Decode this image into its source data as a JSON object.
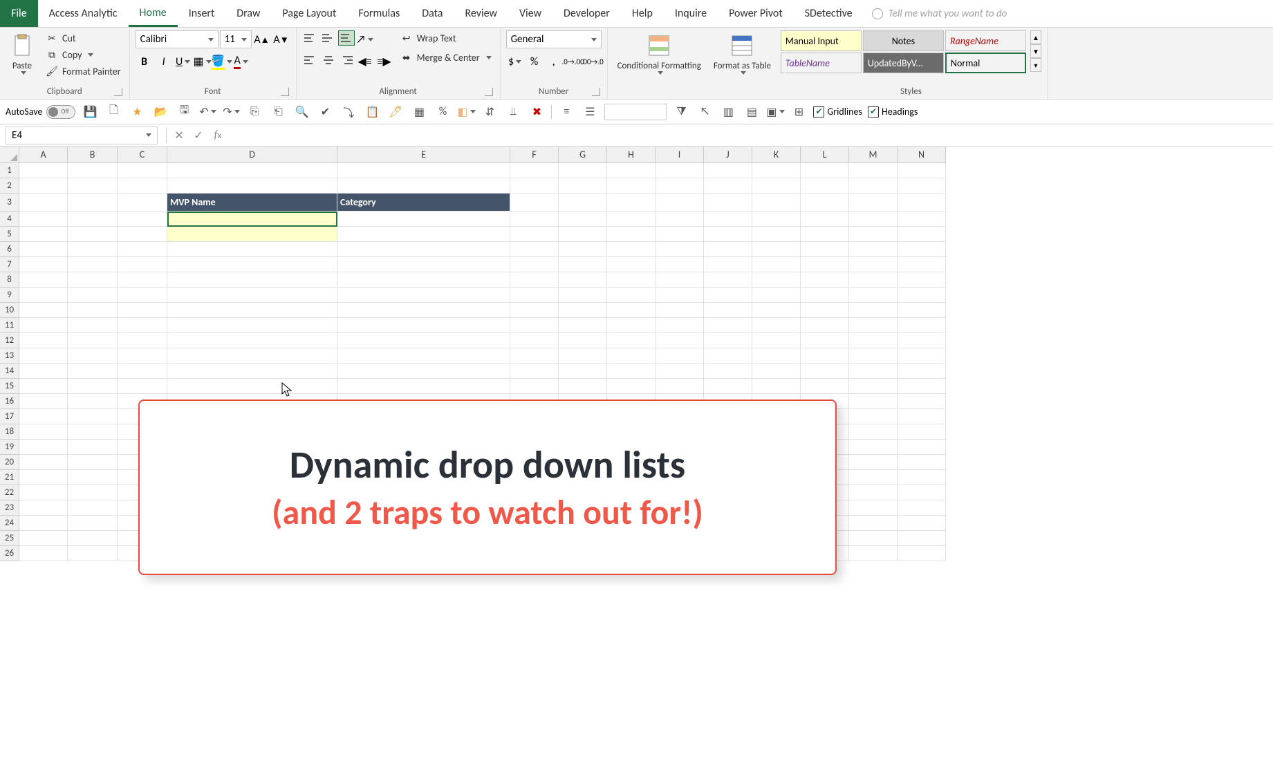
{
  "tabs": {
    "file": "File",
    "items": [
      "Access Analytic",
      "Home",
      "Insert",
      "Draw",
      "Page Layout",
      "Formulas",
      "Data",
      "Review",
      "View",
      "Developer",
      "Help",
      "Inquire",
      "Power Pivot",
      "SDetective"
    ],
    "active": "Home",
    "tell_me": "Tell me what you want to do"
  },
  "ribbon": {
    "clipboard": {
      "label": "Clipboard",
      "paste": "Paste",
      "cut": "Cut",
      "copy": "Copy",
      "format_painter": "Format Painter"
    },
    "font": {
      "label": "Font",
      "name": "Calibri",
      "size": "11"
    },
    "alignment": {
      "label": "Alignment",
      "wrap": "Wrap Text",
      "merge": "Merge & Center"
    },
    "number": {
      "label": "Number",
      "format": "General"
    },
    "styles": {
      "label": "Styles",
      "cond": "Conditional Formatting",
      "fat": "Format as Table",
      "cells": [
        {
          "text": "Manual Input",
          "bg": "#ffffcc",
          "color": "#000",
          "italic": false
        },
        {
          "text": "Notes",
          "bg": "#d9d9d9",
          "color": "#333",
          "italic": false
        },
        {
          "text": "RangeName",
          "bg": "#fff",
          "color": "#c00000",
          "italic": true
        },
        {
          "text": "TableName",
          "bg": "#fff",
          "color": "#7030a0",
          "italic": true
        },
        {
          "text": "UpdatedByV...",
          "bg": "#6b6b6b",
          "color": "#fff",
          "italic": false
        },
        {
          "text": "Normal",
          "bg": "#fff",
          "color": "#000",
          "italic": false
        }
      ]
    }
  },
  "qat": {
    "autosave_label": "AutoSave",
    "autosave_state": "Off",
    "gridlines": "Gridlines",
    "headings": "Headings"
  },
  "namebox": "E4",
  "grid": {
    "cols": [
      "A",
      "B",
      "C",
      "D",
      "E",
      "F",
      "G",
      "H",
      "I",
      "J",
      "K",
      "L",
      "M",
      "N"
    ],
    "rows": 26,
    "headers": {
      "d3": "MVP Name",
      "e3": "Category"
    }
  },
  "callout": {
    "line1": "Dynamic drop down lists",
    "line2": "(and 2 traps to watch out for!)"
  }
}
